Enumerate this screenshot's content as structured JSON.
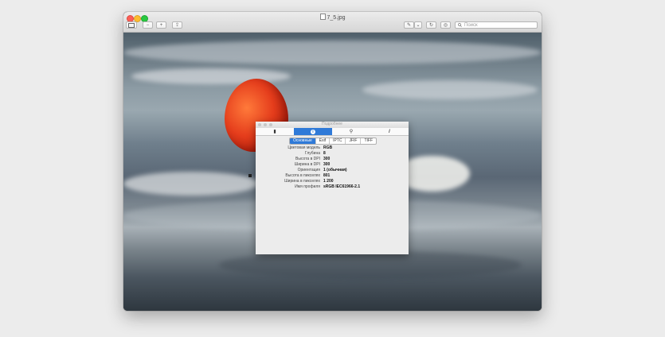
{
  "window": {
    "title": "7_5.jpg"
  },
  "toolbar": {
    "sidebar_icon": "sidebar-icon",
    "zoom_out_label": "−",
    "zoom_in_label": "+",
    "share_label": "⇪",
    "markup_label": "✎",
    "markup_menu_label": "⌄",
    "rotate_label": "↻",
    "annotate_label": "◎",
    "search_placeholder": "Поиск"
  },
  "inspector": {
    "title": "Подробнее",
    "tabs": [
      {
        "icon": "document-icon",
        "glyph": "▮"
      },
      {
        "icon": "info-icon",
        "glyph": "i"
      },
      {
        "icon": "magnifier-icon",
        "glyph": "⚲"
      },
      {
        "icon": "pencil-icon",
        "glyph": "/"
      }
    ],
    "segments": [
      "Основные",
      "Exif",
      "IPTC",
      "JFIF",
      "TIFF"
    ],
    "properties": [
      {
        "label": "Цветовая модель",
        "value": "RGB"
      },
      {
        "label": "Глубина",
        "value": "8"
      },
      {
        "label": "Высота в DPI",
        "value": "300"
      },
      {
        "label": "Ширина в DPI",
        "value": "300"
      },
      {
        "label": "Ориентация",
        "value": "1 (обычная)"
      },
      {
        "label": "Высота в пикселях",
        "value": "801"
      },
      {
        "label": "Ширина в пикселях",
        "value": "1 200"
      },
      {
        "label": "Имя профиля",
        "value": "sRGB IEC61966-2.1"
      }
    ]
  },
  "colors": {
    "accent": "#2f7ad8",
    "balloon": "#e53d1c"
  }
}
